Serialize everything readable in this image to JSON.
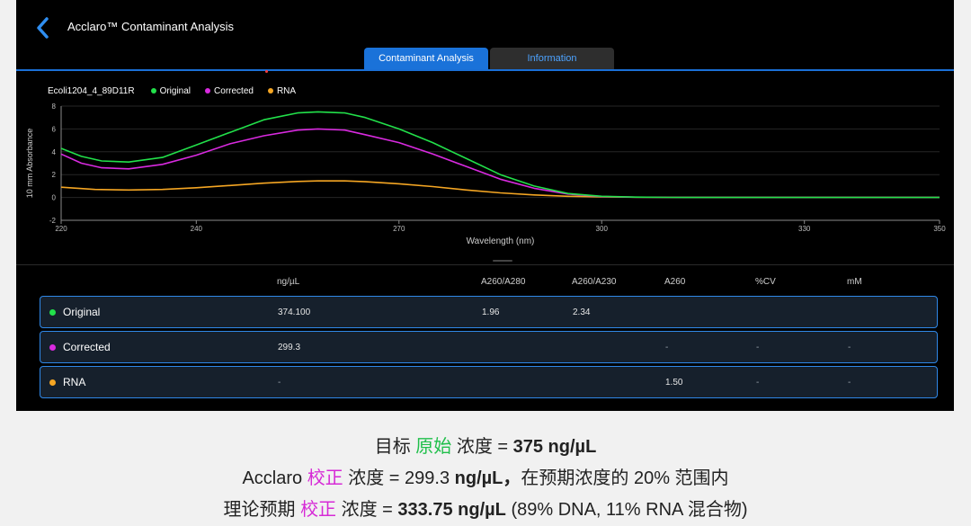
{
  "app": {
    "title": "Acclaro™ Contaminant Analysis",
    "tabs": [
      {
        "label": "Contaminant Analysis",
        "active": true
      },
      {
        "label": "Information",
        "active": false
      }
    ]
  },
  "legend": {
    "sample": "Ecoli1204_4_89D11R",
    "items": [
      {
        "label": "Original",
        "color": "#22e04a"
      },
      {
        "label": "Corrected",
        "color": "#d92ae0"
      },
      {
        "label": "RNA",
        "color": "#f5a623"
      }
    ]
  },
  "chart_data": {
    "type": "line",
    "xlabel": "Wavelength (nm)",
    "ylabel": "10 mm Absorbance",
    "xlim": [
      220,
      350
    ],
    "ylim": [
      -2,
      8
    ],
    "xticks": [
      220,
      240,
      270,
      300,
      330,
      350
    ],
    "yticks": [
      -2,
      0,
      2,
      4,
      6,
      8
    ],
    "grid": true,
    "legend_position": "top-left",
    "series": [
      {
        "name": "Original",
        "color": "#22e04a",
        "x": [
          220,
          223,
          226,
          230,
          235,
          240,
          245,
          250,
          255,
          258,
          262,
          265,
          270,
          275,
          280,
          285,
          290,
          295,
          300,
          305,
          310,
          320,
          330,
          340,
          350
        ],
        "y": [
          4.3,
          3.6,
          3.2,
          3.1,
          3.5,
          4.6,
          5.7,
          6.8,
          7.4,
          7.5,
          7.4,
          7.0,
          6.0,
          4.8,
          3.4,
          2.0,
          1.0,
          0.35,
          0.1,
          0.03,
          0.01,
          0.0,
          0.0,
          0.0,
          0.0
        ]
      },
      {
        "name": "Corrected",
        "color": "#d92ae0",
        "x": [
          220,
          223,
          226,
          230,
          235,
          240,
          245,
          250,
          255,
          258,
          262,
          265,
          270,
          275,
          280,
          285,
          290,
          295,
          300,
          305,
          310,
          320,
          330,
          340,
          350
        ],
        "y": [
          3.8,
          3.0,
          2.6,
          2.5,
          2.9,
          3.7,
          4.7,
          5.4,
          5.9,
          6.0,
          5.9,
          5.5,
          4.8,
          3.8,
          2.7,
          1.6,
          0.8,
          0.3,
          0.08,
          0.02,
          0.01,
          0.0,
          0.0,
          0.0,
          0.0
        ]
      },
      {
        "name": "RNA",
        "color": "#f5a623",
        "x": [
          220,
          225,
          230,
          235,
          240,
          245,
          250,
          255,
          258,
          262,
          265,
          270,
          275,
          280,
          285,
          290,
          295,
          300,
          305,
          310,
          320,
          330,
          340,
          350
        ],
        "y": [
          0.9,
          0.7,
          0.65,
          0.7,
          0.85,
          1.05,
          1.25,
          1.4,
          1.45,
          1.45,
          1.38,
          1.2,
          0.95,
          0.65,
          0.4,
          0.22,
          0.1,
          0.05,
          0.02,
          0.01,
          0.0,
          0.0,
          0.0,
          0.0
        ]
      }
    ]
  },
  "table": {
    "headers": [
      "ng/µL",
      "A260/A280",
      "A260/A230",
      "A260",
      "%CV",
      "mM"
    ],
    "rows": [
      {
        "name": "Original",
        "color": "#22e04a",
        "ng": "374.100",
        "a280": "1.96",
        "a230": "2.34",
        "a260": "",
        "cv": "",
        "mm": ""
      },
      {
        "name": "Corrected",
        "color": "#d92ae0",
        "ng": "299.3",
        "a280": "",
        "a230": "",
        "a260": "-",
        "cv": "-",
        "mm": "-"
      },
      {
        "name": "RNA",
        "color": "#f5a623",
        "ng": "-",
        "a280": "",
        "a230": "",
        "a260": "1.50",
        "cv": "-",
        "mm": "-"
      }
    ]
  },
  "caption": {
    "line1": {
      "prefix": "目标 ",
      "highlight": "原始",
      "mid": " 浓度 = ",
      "value": "375 ng/µL"
    },
    "line2": {
      "prefix": "Acclaro ",
      "highlight": "校正",
      "mid": " 浓度 = 299.3 ",
      "value": "ng/µL，",
      "suffix": "在预期浓度的 20% 范围内"
    },
    "line3": {
      "prefix": "理论预期 ",
      "highlight": "校正",
      "mid": " 浓度 = ",
      "value": "333.75 ng/µL",
      "suffix": " (89% DNA, 11% RNA 混合物)"
    }
  }
}
